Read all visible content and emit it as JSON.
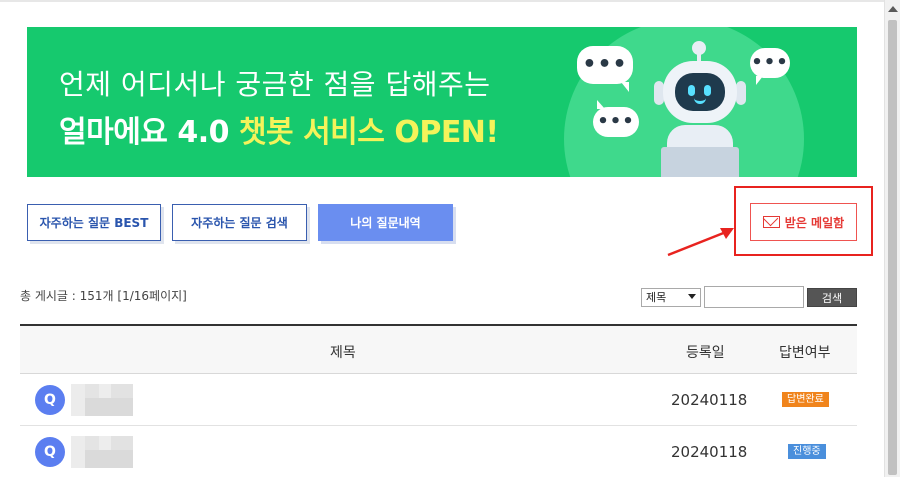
{
  "banner": {
    "headline": "언제 어디서나 궁금한 점을 답해주는",
    "sub_white": "얼마에요 4.0 ",
    "sub_yellow": "챗봇 서비스 OPEN!"
  },
  "tabs": [
    {
      "label": "자주하는 질문 BEST",
      "active": false
    },
    {
      "label": "자주하는 질문 검색",
      "active": false
    },
    {
      "label": "나의 질문내역",
      "active": true
    }
  ],
  "mailbox": {
    "label": "받은 메일함"
  },
  "list": {
    "total_text": "총 게시글 : 151개 [1/16페이지]",
    "search": {
      "select_value": "제목",
      "input_value": "",
      "button_label": "검색"
    },
    "columns": {
      "title": "제목",
      "date": "등록일",
      "answer": "답변여부"
    },
    "rows": [
      {
        "icon": "Q",
        "date": "20240118",
        "status": "답변완료"
      },
      {
        "icon": "Q",
        "date": "20240118",
        "status": "진행중"
      }
    ]
  },
  "colors": {
    "banner_green": "#16c96e",
    "accent_blue": "#6a8ef0",
    "highlight_red": "#e8231f",
    "status_done": "#f0841c",
    "status_wip": "#4a8fdc"
  }
}
